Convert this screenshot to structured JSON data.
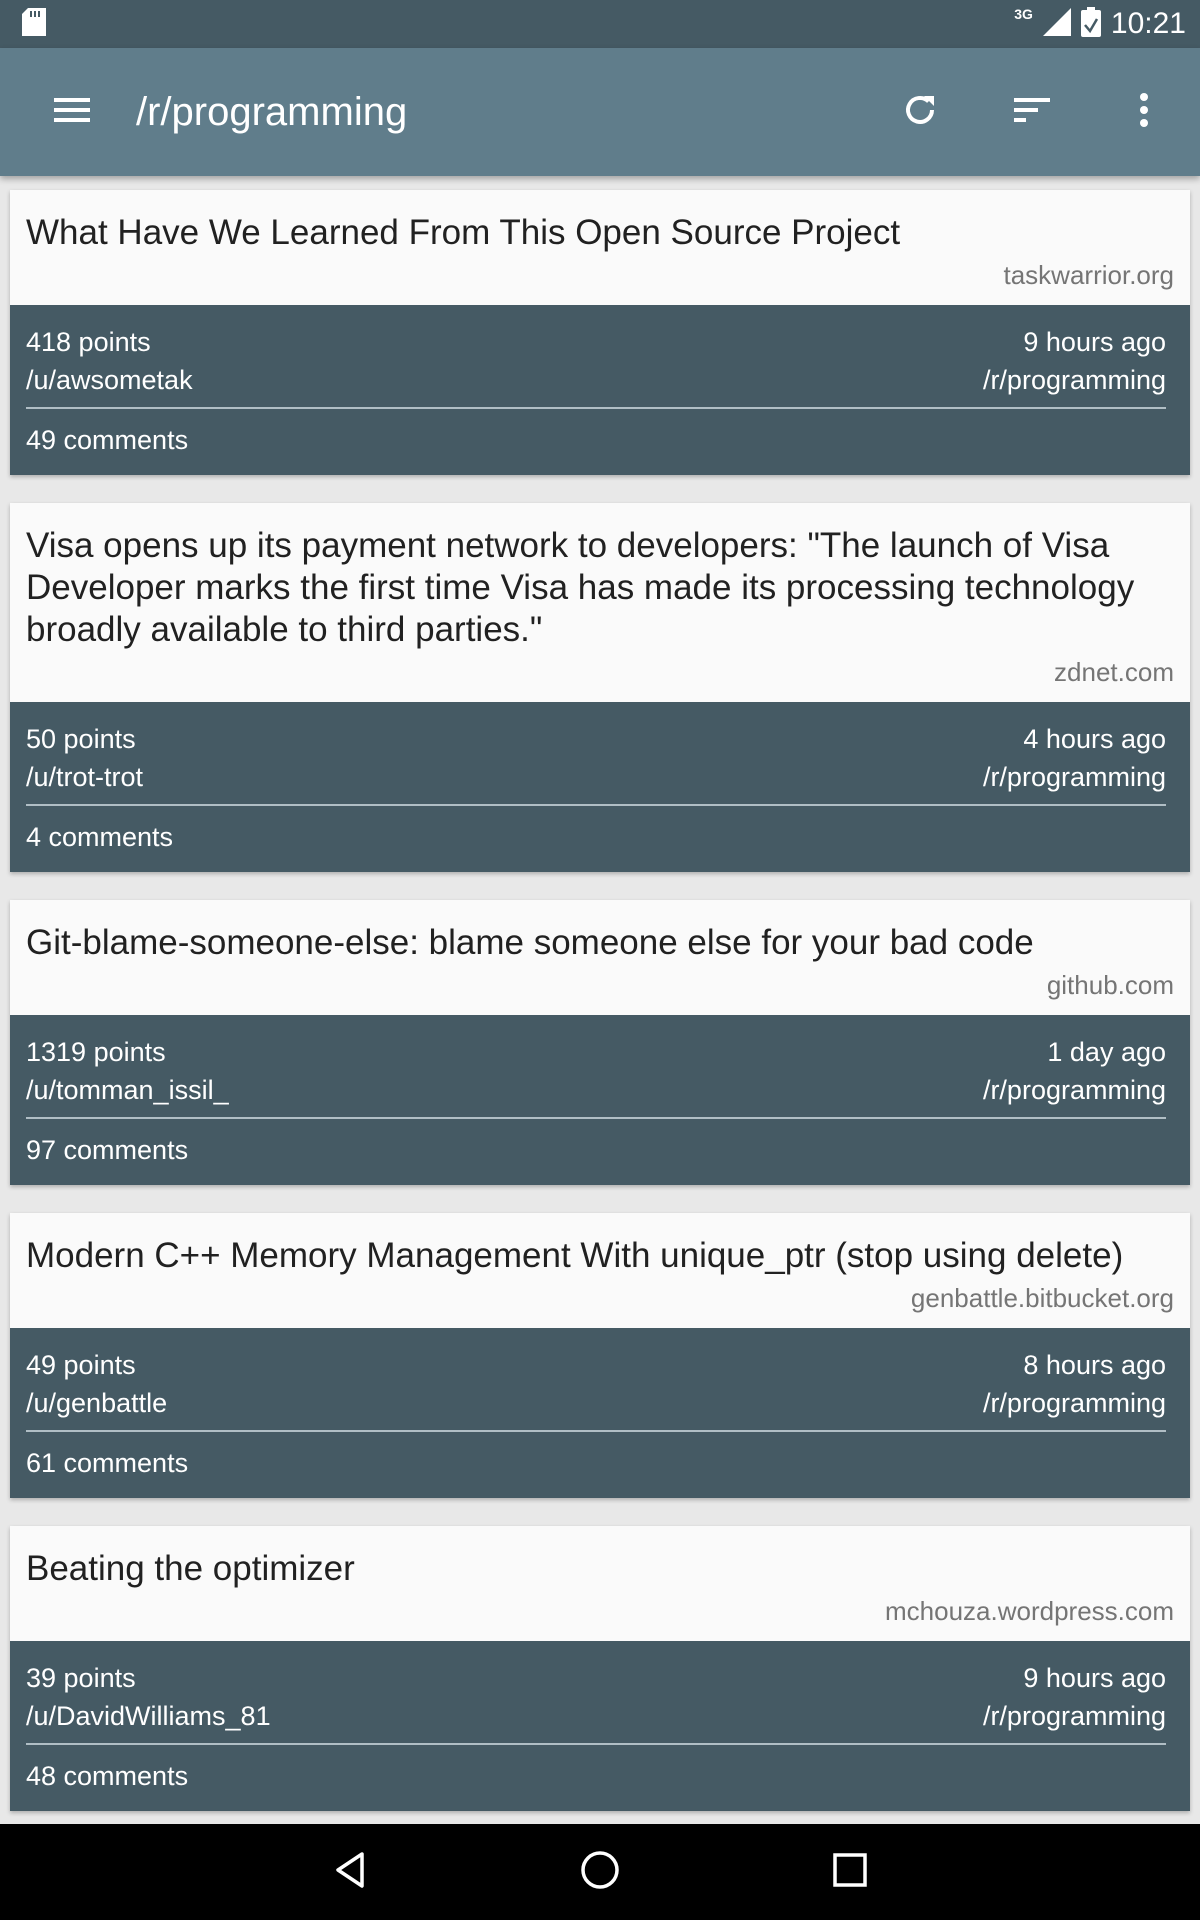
{
  "status": {
    "network": "3G",
    "time": "10:21",
    "icons": [
      "sd-card-icon",
      "signal-icon",
      "battery-icon"
    ]
  },
  "toolbar": {
    "title": "/r/programming",
    "icons": [
      "menu-icon",
      "refresh-icon",
      "sort-icon",
      "more-vert-icon"
    ]
  },
  "posts": [
    {
      "title": "What Have We Learned From This Open Source Project",
      "domain": "taskwarrior.org",
      "points": "418 points",
      "age": "9 hours ago",
      "author": "/u/awsometak",
      "subreddit": "/r/programming",
      "comments": "49 comments"
    },
    {
      "title": "Visa opens up its payment network to developers: \"The launch of Visa Developer marks the first time Visa has made its processing technology broadly available to third parties.\"",
      "domain": "zdnet.com",
      "points": "50 points",
      "age": "4 hours ago",
      "author": "/u/trot-trot",
      "subreddit": "/r/programming",
      "comments": "4 comments"
    },
    {
      "title": "Git-blame-someone-else: blame someone else for your bad code",
      "domain": "github.com",
      "points": "1319 points",
      "age": "1 day ago",
      "author": "/u/tomman_issil_",
      "subreddit": "/r/programming",
      "comments": "97 comments"
    },
    {
      "title": "Modern C++ Memory Management With unique_ptr (stop using delete)",
      "domain": "genbattle.bitbucket.org",
      "points": "49 points",
      "age": "8 hours ago",
      "author": "/u/genbattle",
      "subreddit": "/r/programming",
      "comments": "61 comments"
    },
    {
      "title": "Beating the optimizer",
      "domain": "mchouza.wordpress.com",
      "points": "39 points",
      "age": "9 hours ago",
      "author": "/u/DavidWilliams_81",
      "subreddit": "/r/programming",
      "comments": "48 comments"
    }
  ],
  "navbar": {
    "icons": [
      "back-icon",
      "home-icon",
      "recents-icon"
    ]
  },
  "colors": {
    "statusbar": "#455a64",
    "toolbar": "#607d8b",
    "meta_bg": "#455a64",
    "background": "#e8e8e8"
  }
}
